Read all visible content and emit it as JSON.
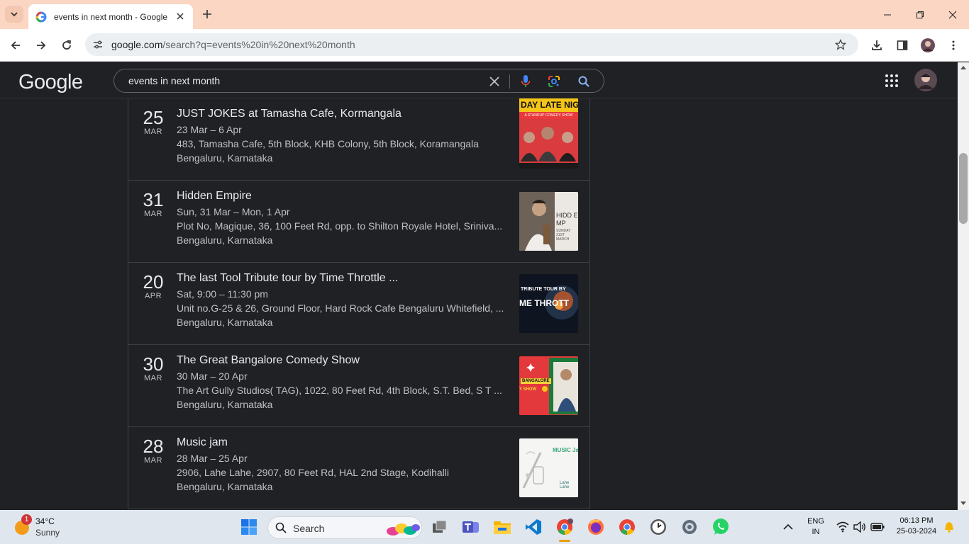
{
  "browser": {
    "tab_title": "events in next month - Google Search",
    "url_host": "google.com",
    "url_path": "/search?q=events%20in%20next%20month"
  },
  "google": {
    "logo": "Google",
    "query": "events in next month"
  },
  "events": [
    {
      "day": "25",
      "month": "MAR",
      "title": "JUST JOKES at Tamasha Cafe, Kormangala",
      "date": "23 Mar – 6 Apr",
      "address": "483, Tamasha Cafe, 5th Block, KHB Colony, 5th Block, Koramangala",
      "city": "Bengaluru, Karnataka",
      "thumb_text": "DAY LATE NIG",
      "thumb_sub": "A STANDUP COMEDY SHOW"
    },
    {
      "day": "31",
      "month": "MAR",
      "title": "Hidden Empire",
      "date": "Sun, 31 Mar – Mon, 1 Apr",
      "address": "Plot No, Magique, 36, 100 Feet Rd, opp. to Shilton Royale Hotel, Sriniva...",
      "city": "Bengaluru, Karnataka",
      "thumb_text": "HIDD EMP",
      "thumb_sub": "SUNDAY 31ST MARCH"
    },
    {
      "day": "20",
      "month": "APR",
      "title": "The last Tool Tribute tour by Time Throttle ...",
      "date": "Sat, 9:00 – 11:30 pm",
      "address": "Unit no.G-25 & 26, Ground Floor, Hard Rock Cafe Bengaluru Whitefield, ...",
      "city": "Bengaluru, Karnataka",
      "thumb_text": "ME THROTT",
      "thumb_sub": "TRIBUTE TOUR BY"
    },
    {
      "day": "30",
      "month": "MAR",
      "title": "The Great Bangalore Comedy Show",
      "date": "30 Mar – 20 Apr",
      "address": "The Art Gully Studios( TAG), 1022, 80 Feet Rd, 4th Block, S.T. Bed, S T ...",
      "city": "Bengaluru, Karnataka",
      "thumb_text": "BANGALORE",
      "thumb_sub": "Y SHOW"
    },
    {
      "day": "28",
      "month": "MAR",
      "title": "Music jam",
      "date": "28 Mar – 25 Apr",
      "address": "2906, Lahe Lahe, 2907, 80 Feet Rd, HAL 2nd Stage, Kodihalli",
      "city": "Bengaluru, Karnataka",
      "thumb_text": "MUSIC Ja",
      "thumb_sub": "Lahe Lahe"
    }
  ],
  "taskbar": {
    "weather_temp": "34°C",
    "weather_desc": "Sunny",
    "weather_badge": "1",
    "search_label": "Search",
    "lang1": "ENG",
    "lang2": "IN",
    "time": "06:13 PM",
    "date": "25-03-2024"
  }
}
